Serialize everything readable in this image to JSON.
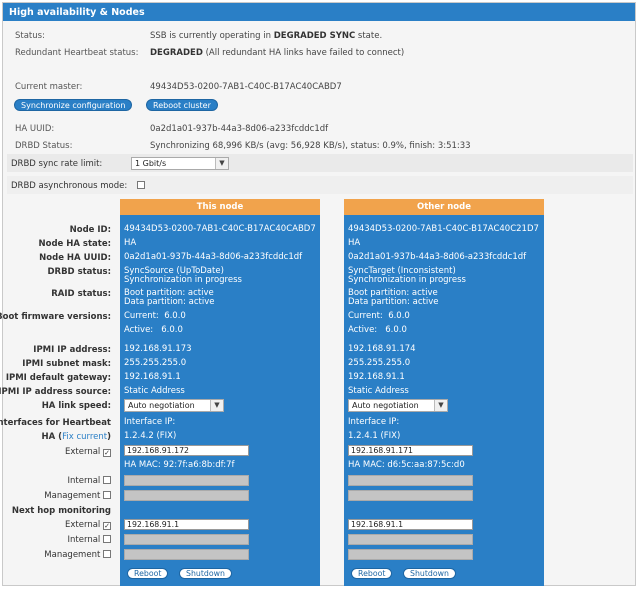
{
  "panel": {
    "title": "High availability & Nodes"
  },
  "status": {
    "label": "Status:",
    "prefix": "SSB is currently operating in",
    "state": "DEGRADED SYNC",
    "suffix": "state."
  },
  "heartbeat": {
    "label": "Redundant Heartbeat status:",
    "state": "DEGRADED",
    "detail": "(All redundant HA links have failed to connect)"
  },
  "master": {
    "label": "Current master:",
    "value": "49434D53-0200-7AB1-C40C-B17AC40CABD7"
  },
  "buttons": {
    "sync": "Synchronize configuration",
    "reboot_cluster": "Reboot cluster"
  },
  "ha_uuid": {
    "label": "HA UUID:",
    "value": "0a2d1a01-937b-44a3-8d06-a233fcddc1df"
  },
  "drbd_status": {
    "label": "DRBD Status:",
    "value": "Synchronizing 68,996 KB/s (avg: 56,928 KB/s), status: 0.9%, finish: 3:51:33"
  },
  "drbd_rate": {
    "label": "DRBD sync rate limit:",
    "value": "1 Gbit/s"
  },
  "drbd_async": {
    "label": "DRBD asynchronous mode:",
    "checked": false
  },
  "left_labels": {
    "node_id": "Node ID:",
    "node_ha_state": "Node HA state:",
    "node_ha_uuid": "Node HA UUID:",
    "drbd_status": "DRBD status:",
    "raid_status": "RAID status:",
    "boot_firmware": "Boot firmware versions:",
    "ipmi_ip": "IPMI IP address:",
    "ipmi_mask": "IPMI subnet mask:",
    "ipmi_gw": "IPMI default gateway:",
    "ipmi_source": "IPMI IP address source:",
    "ha_link_speed": "HA link speed:",
    "interfaces_hb": "Interfaces for Heartbeat",
    "ha": "HA (",
    "fix_current": "Fix current",
    "ha_close": ")",
    "external": "External",
    "internal": "Internal",
    "management": "Management",
    "next_hop": "Next hop monitoring",
    "nh_external": "External",
    "nh_internal": "Internal",
    "nh_management": "Management"
  },
  "nodes": [
    {
      "title": "This node",
      "node_id": "49434D53-0200-7AB1-C40C-B17AC40CABD7",
      "ha_state": "HA",
      "ha_uuid": "0a2d1a01-937b-44a3-8d06-a233fcddc1df",
      "drbd_1": "SyncSource (UpToDate)",
      "drbd_2": "Synchronization in progress",
      "raid_1": "Boot partition: active",
      "raid_2": "Data partition: active",
      "fw_current": "Current:  6.0.0",
      "fw_active": "Active:   6.0.0",
      "ipmi_ip": "192.168.91.173",
      "ipmi_mask": "255.255.255.0",
      "ipmi_gw": "192.168.91.1",
      "ipmi_source": "Static Address",
      "link_speed": "Auto negotiation",
      "iface_ip_label": "Interface IP:",
      "iface_ip": "1.2.4.2",
      "fix": "(FIX)",
      "external_ip": "192.168.91.172",
      "ha_mac": "HA MAC: 92:7f:a6:8b:df:7f",
      "nh_external": "192.168.91.1",
      "reboot": "Reboot",
      "shutdown": "Shutdown"
    },
    {
      "title": "Other node",
      "node_id": "49434D53-0200-7AB1-C40C-B17AC40C21D7",
      "ha_state": "HA",
      "ha_uuid": "0a2d1a01-937b-44a3-8d06-a233fcddc1df",
      "drbd_1": "SyncTarget (Inconsistent)",
      "drbd_2": "Synchronization in progress",
      "raid_1": "Boot partition: active",
      "raid_2": "Data partition: active",
      "fw_current": "Current:  6.0.0",
      "fw_active": "Active:   6.0.0",
      "ipmi_ip": "192.168.91.174",
      "ipmi_mask": "255.255.255.0",
      "ipmi_gw": "192.168.91.1",
      "ipmi_source": "Static Address",
      "link_speed": "Auto negotiation",
      "iface_ip_label": "Interface IP:",
      "iface_ip": "1.2.4.1",
      "fix": "(FIX)",
      "external_ip": "192.168.91.171",
      "ha_mac": "HA MAC: d6:5c:aa:87:5c:d0",
      "nh_external": "192.168.91.1",
      "reboot": "Reboot",
      "shutdown": "Shutdown"
    }
  ],
  "icons": {
    "dropdown": "chevron-down-icon",
    "check": "checkmark-icon"
  },
  "colors": {
    "header_blue": "#2a7fc6",
    "node_header_orange": "#f1a34c"
  }
}
